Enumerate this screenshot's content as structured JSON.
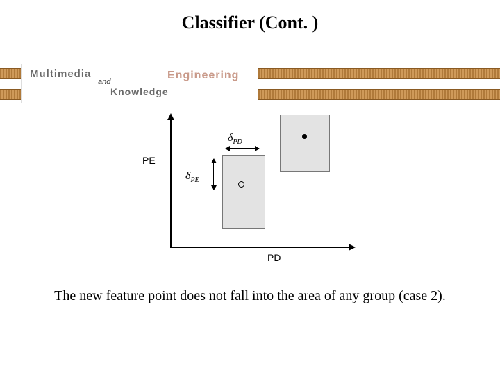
{
  "title": "Classifier (Cont. )",
  "banner": {
    "multimedia": "Multimedia",
    "and": "and",
    "engineering": "Engineering",
    "knowledge": "Knowledge"
  },
  "diagram": {
    "y_axis_label": "PE",
    "x_axis_label": "PD",
    "delta_pd_symbol": "δ",
    "delta_pd_sub": "PD",
    "delta_pe_symbol": "δ",
    "delta_pe_sub": "PE"
  },
  "caption": "The new feature point does not fall into the area of any group (case 2)."
}
